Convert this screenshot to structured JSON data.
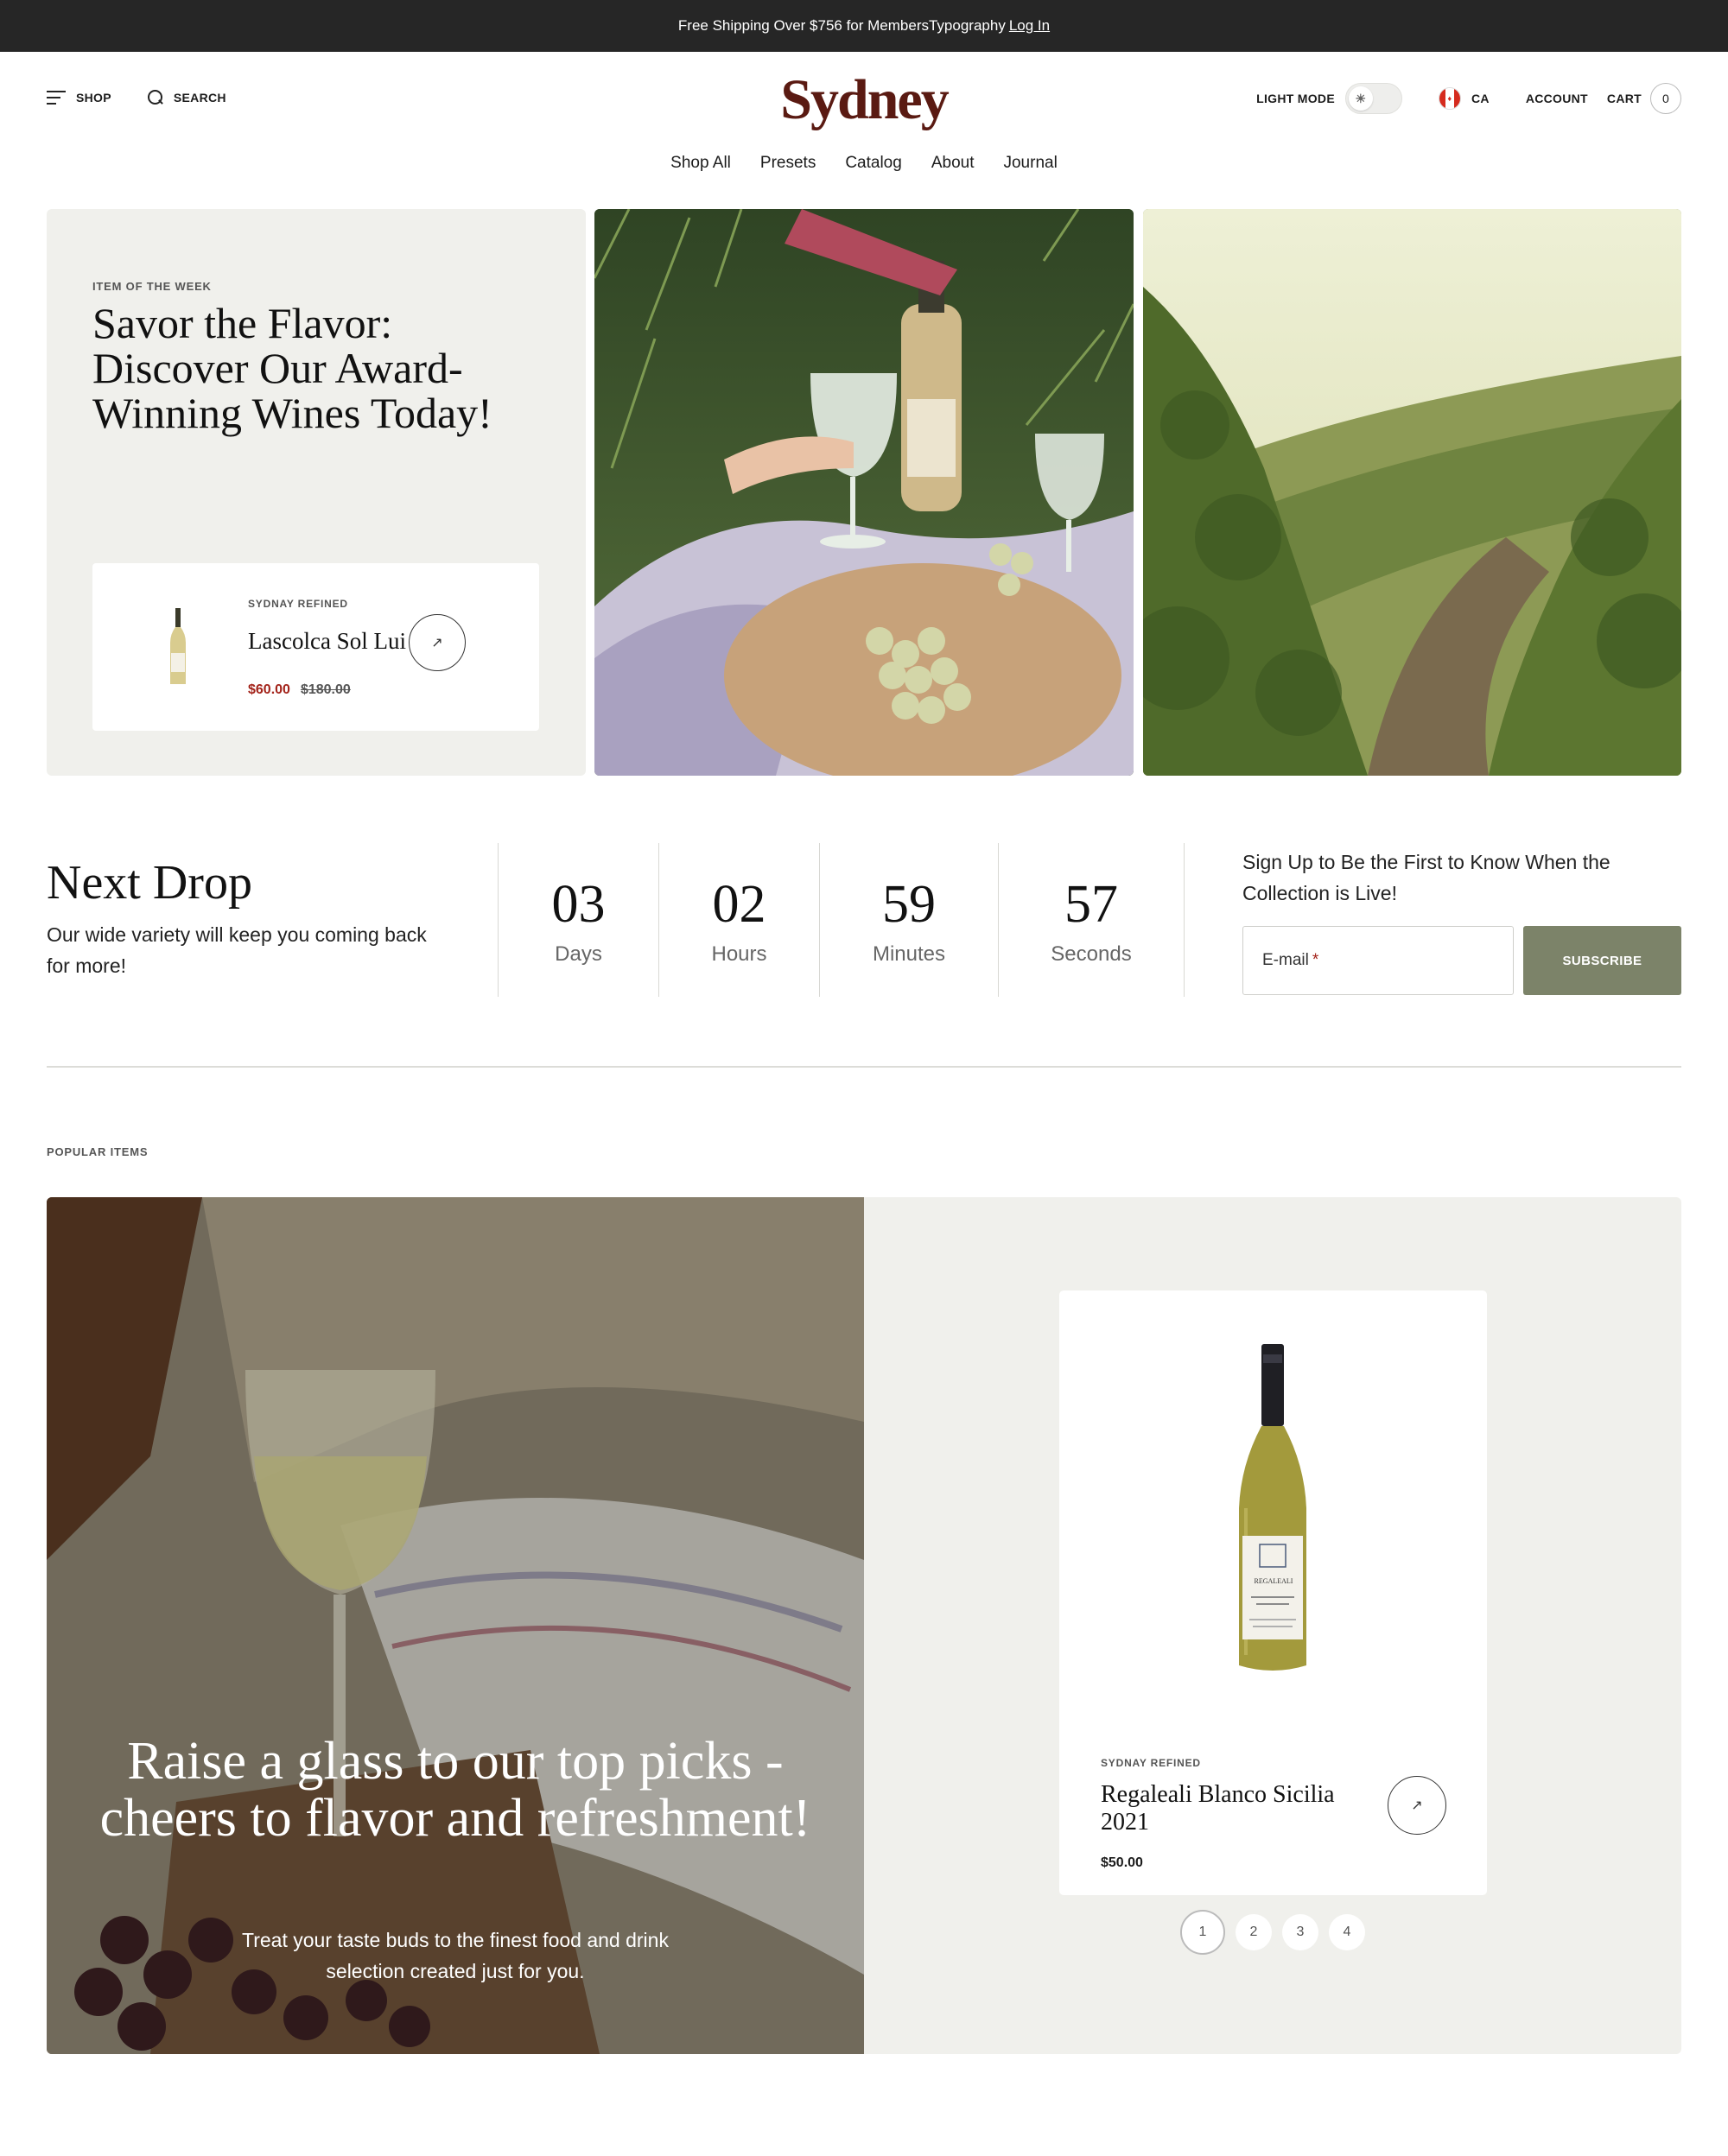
{
  "announcement": {
    "text": "Free Shipping Over $756 for MembersTypography",
    "link": "Log In"
  },
  "header": {
    "shop_label": "SHOP",
    "search_label": "SEARCH",
    "logo": "Sydney",
    "mode_label": "LIGHT MODE",
    "locale": "CA",
    "account_label": "ACCOUNT",
    "cart_label": "CART",
    "cart_count": "0"
  },
  "nav": [
    "Shop All",
    "Presets",
    "Catalog",
    "About",
    "Journal"
  ],
  "hero": {
    "eyebrow": "ITEM OF THE WEEK",
    "title": "Savor the Flavor: Discover Our Award-Winning Wines Today!",
    "product": {
      "vendor": "SYDNAY REFINED",
      "name": "Lascolca Sol Lui",
      "sale_price": "$60.00",
      "original_price": "$180.00",
      "arrow": "↗"
    }
  },
  "next_drop": {
    "title": "Next Drop",
    "subtitle": "Our wide variety will keep you coming back for more!",
    "countdown": [
      {
        "value": "03",
        "label": "Days"
      },
      {
        "value": "02",
        "label": "Hours"
      },
      {
        "value": "59",
        "label": "Minutes"
      },
      {
        "value": "57",
        "label": "Seconds"
      }
    ],
    "signup_text": "Sign Up to Be the First to Know When the Collection is Live!",
    "email_placeholder": "E-mail",
    "required_mark": "*",
    "subscribe_label": "SUBSCRIBE"
  },
  "popular": {
    "label": "POPULAR ITEMS",
    "promo_title": "Raise a glass to our top picks - cheers to flavor and refreshment!",
    "promo_sub": "Treat your taste buds to the finest food and drink selection created just for you.",
    "product": {
      "vendor": "SYDNAY REFINED",
      "name": "Regaleali Blanco Sicilia 2021",
      "price": "$50.00",
      "bottle_label": "REGALEALI",
      "arrow": "↗"
    },
    "pages": [
      "1",
      "2",
      "3",
      "4"
    ]
  },
  "icons": {
    "menu": "menu-icon",
    "search": "search-icon",
    "sun": "sun-icon",
    "flag": "canada-flag-icon",
    "arrow": "arrow-up-right-icon"
  },
  "colors": {
    "announcement_bg": "#262626",
    "logo": "#5a1a12",
    "sale": "#a3231a",
    "subscribe_bg": "#7c8369",
    "panel_bg": "#f0f0ec"
  }
}
